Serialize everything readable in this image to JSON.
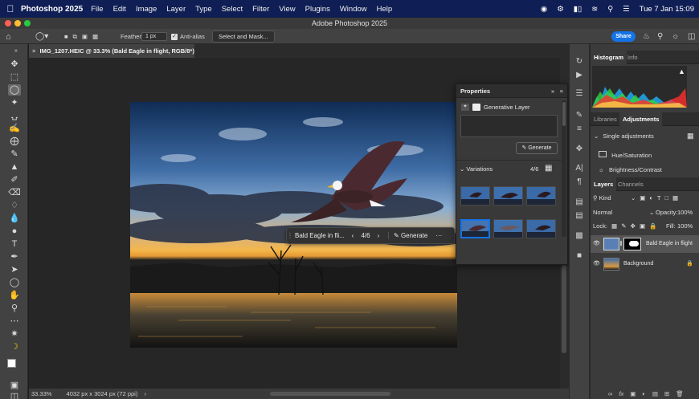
{
  "menubar": {
    "app_name": "Photoshop 2025",
    "items": [
      "File",
      "Edit",
      "Image",
      "Layer",
      "Type",
      "Select",
      "Filter",
      "View",
      "Plugins",
      "Window",
      "Help"
    ],
    "clock": "Tue 7 Jan  15:09"
  },
  "window": {
    "title": "Adobe Photoshop 2025"
  },
  "options": {
    "feather_label": "Feather:",
    "feather_value": "1 px",
    "antialias_label": "Anti-alias",
    "select_mask_label": "Select and Mask...",
    "share_label": "Share"
  },
  "document": {
    "tab_title": "IMG_1207.HEIC @ 33.3% (Bald Eagle in flight, RGB/8*) *",
    "zoom": "33.33%",
    "dimensions": "4032 px x 3024 px (72 ppi)"
  },
  "taskbar": {
    "prompt_text": "Bald Eagle in fli...",
    "variation": "4/6",
    "generate_label": "Generate",
    "more": "···"
  },
  "properties": {
    "title": "Properties",
    "layer_type": "Generative Layer",
    "generate_label": "Generate",
    "variations_label": "Variations",
    "variations_count": "4/6"
  },
  "histogram_panel": {
    "tabs": [
      "Histogram",
      "Info"
    ]
  },
  "adjustments_panel": {
    "tabs": [
      "Libraries",
      "Adjustments"
    ],
    "section": "Single adjustments",
    "items": [
      "Hue/Saturation",
      "Brightness/Contrast"
    ]
  },
  "layers_panel": {
    "tabs": [
      "Layers",
      "Channels"
    ],
    "filter_kind": "Kind",
    "blend_mode": "Normal",
    "opacity_label": "Opacity:",
    "opacity_value": "100%",
    "lock_label": "Lock:",
    "fill_label": "Fill:",
    "fill_value": "100%",
    "layers": [
      {
        "name": "Bald Eagle in flight"
      },
      {
        "name": "Background"
      }
    ],
    "footer_fx": "fx"
  },
  "colors": {
    "menubar": "#0f1e54",
    "accent": "#1473e6",
    "panel_bg": "#3b3b3b"
  }
}
